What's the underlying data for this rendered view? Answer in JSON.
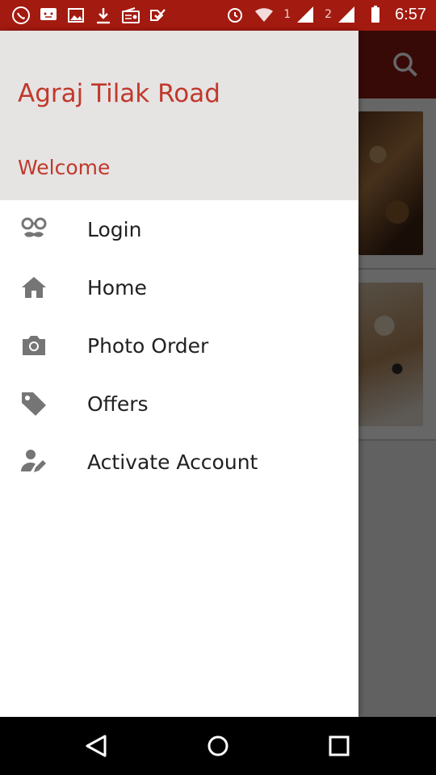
{
  "status_bar": {
    "time": "6:57",
    "sim1": "1",
    "sim2": "2",
    "icons": [
      "whatsapp-icon",
      "message-icon",
      "gallery-icon",
      "download-icon",
      "radio-icon",
      "check-icon",
      "alarm-icon",
      "wifi-icon",
      "signal-icon",
      "signal-icon",
      "battery-icon"
    ]
  },
  "drawer": {
    "title": "Agraj Tilak Road",
    "subtitle": "Welcome",
    "items": [
      {
        "label": "Login",
        "icon": "glasses-mustache-icon"
      },
      {
        "label": "Home",
        "icon": "home-icon"
      },
      {
        "label": "Photo Order",
        "icon": "camera-icon"
      },
      {
        "label": "Offers",
        "icon": "tag-icon"
      },
      {
        "label": "Activate Account",
        "icon": "person-edit-icon"
      }
    ]
  },
  "colors": {
    "accent": "#c0392b",
    "status_bar": "#a31a10",
    "toolbar": "#8b1a12",
    "drawer_header": "#e6e3e3"
  }
}
